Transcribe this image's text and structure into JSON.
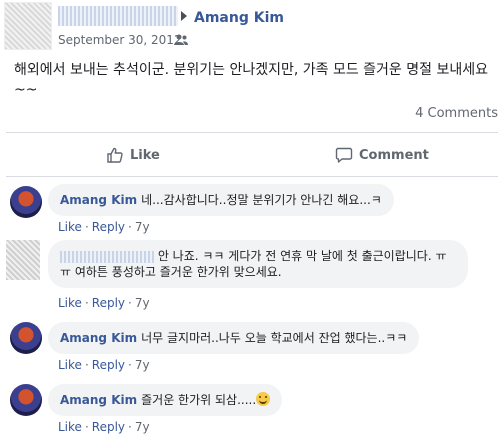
{
  "post": {
    "author": "Amang Kim",
    "date": "September 30, 2012",
    "text": "해외에서 보내는 추석이군. 분위기는 안나겠지만, 가족 모드 즐거운 명절 보내세요~~",
    "comment_count": "4 Comments"
  },
  "actions": {
    "like": "Like",
    "comment": "Comment"
  },
  "comments": [
    {
      "author": "Amang Kim",
      "text": "네...감사합니다..정말 분위기가 안나긴 해요...ㅋ",
      "like": "Like",
      "reply": "Reply",
      "time": "7y"
    },
    {
      "author": "",
      "text": "안 나죠. ㅋㅋ 게다가 전 연휴 막 날에 첫 출근이랍니다. ㅠㅠ 여하튼 풍성하고 즐거운 한가위 맞으세요.",
      "like": "Like",
      "reply": "Reply",
      "time": "7y"
    },
    {
      "author": "Amang Kim",
      "text": "너무 글지마러..나두 오늘 학교에서 잔업 했다는..ㅋㅋ",
      "like": "Like",
      "reply": "Reply",
      "time": "7y"
    },
    {
      "author": "Amang Kim",
      "text": "즐거운 한가위 되삼.....",
      "like": "Like",
      "reply": "Reply",
      "time": "7y"
    }
  ],
  "meta_separator": "·"
}
